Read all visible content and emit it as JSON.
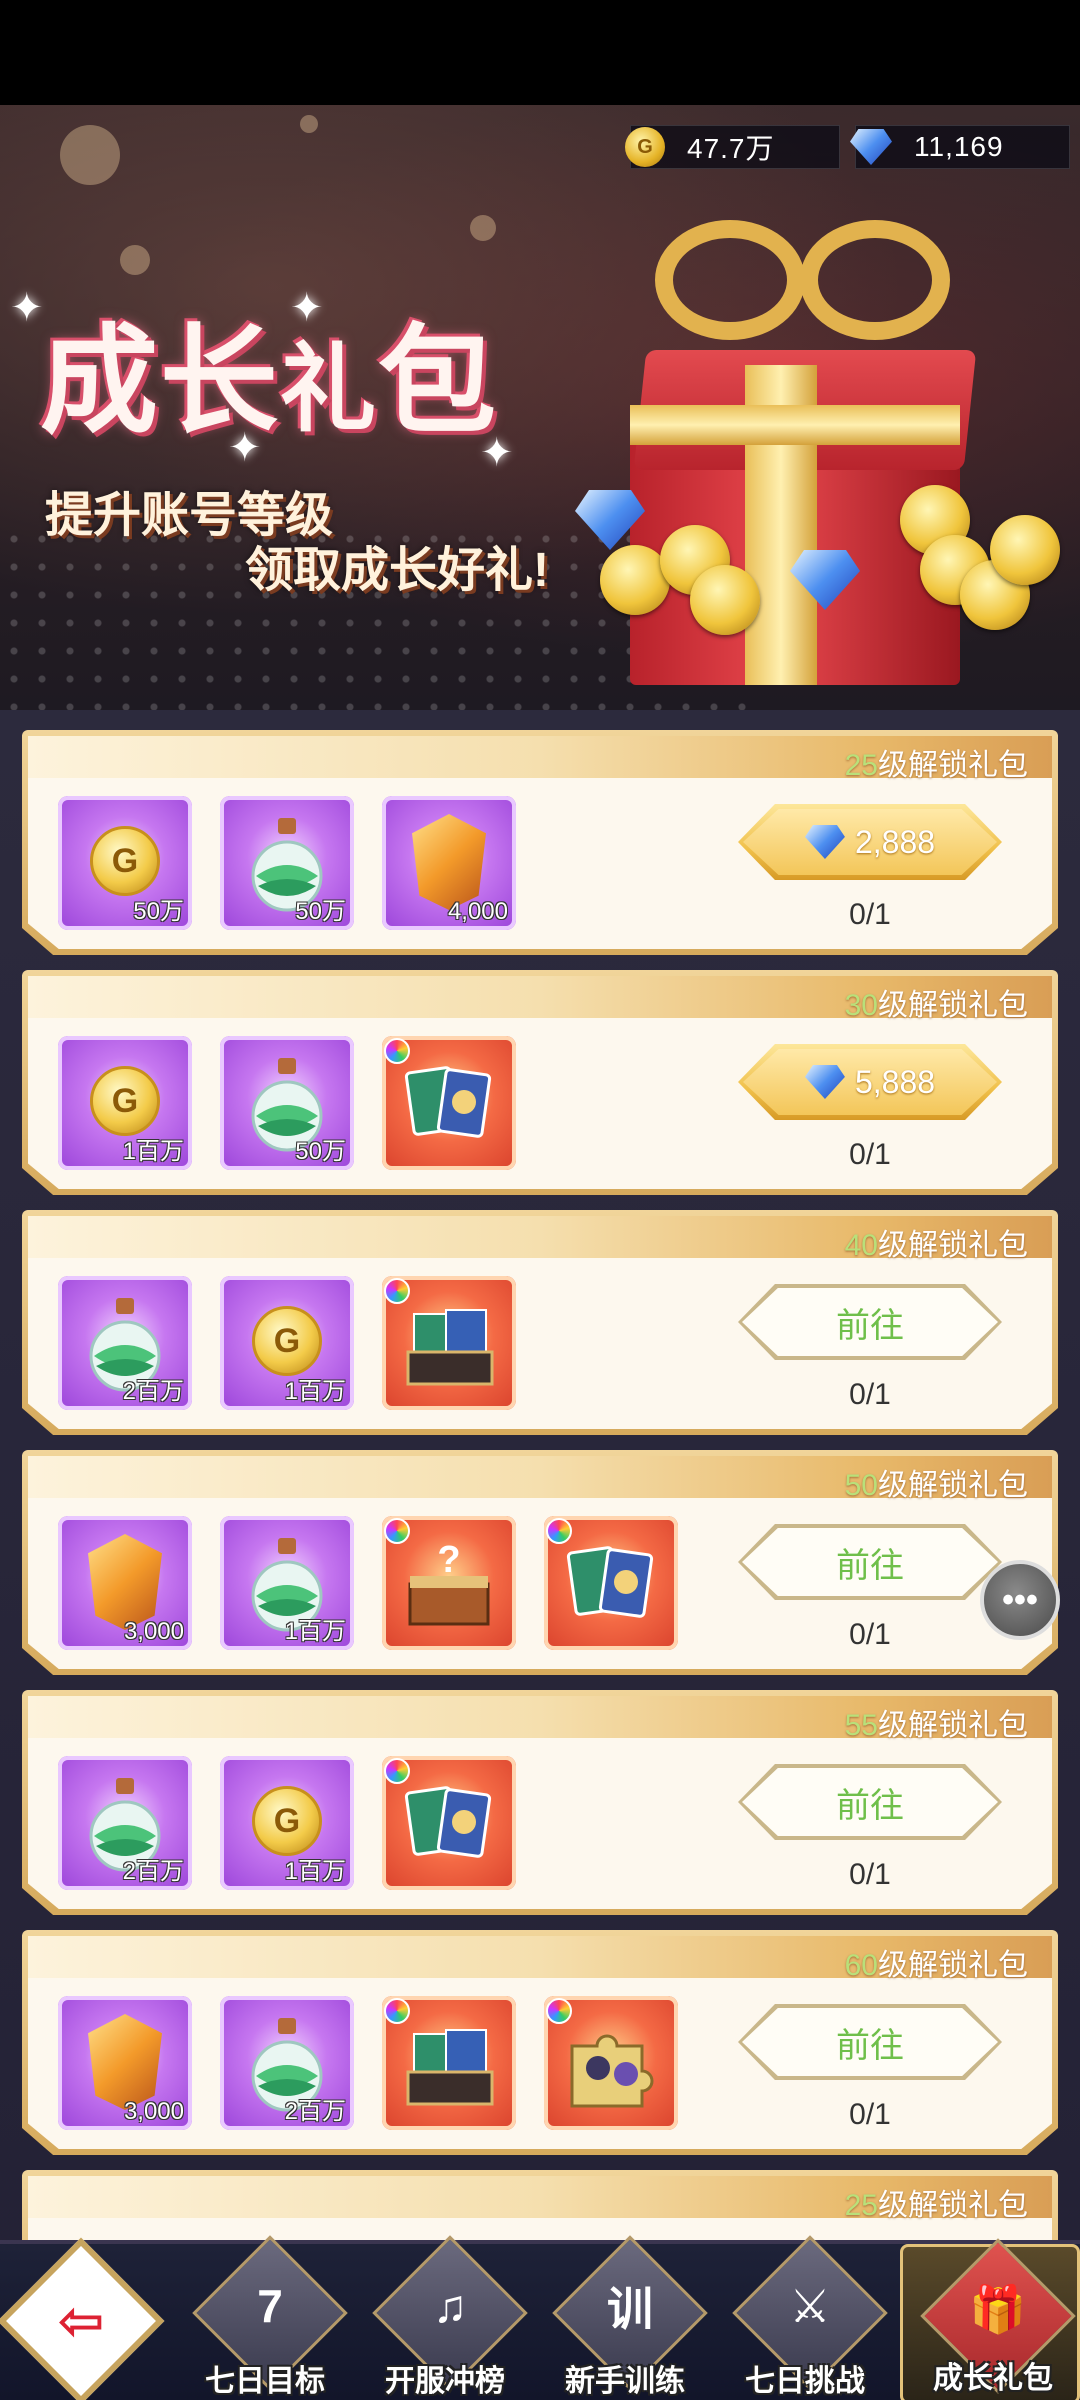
{
  "currency": {
    "gold_icon": "gold-coin-icon",
    "gold_coin_letter": "G",
    "gold_value": "47.7万",
    "gem_icon": "diamond-icon",
    "gem_value": "11,169"
  },
  "banner": {
    "title_part1": "成长",
    "title_part2": "礼",
    "title_part3": "包",
    "subtitle_line1": "提升账号等级",
    "subtitle_line2": "领取成长好礼!"
  },
  "colors": {
    "accent_gold": "#f0c04a",
    "go_text_green": "#6fbf4a",
    "level_text_green": "#b9e07a"
  },
  "packs": [
    {
      "level": "25",
      "suffix": "级解锁礼包",
      "items": [
        {
          "icon": "gold-coin-icon",
          "glyph": "G",
          "qty": "50万",
          "bg": "purple"
        },
        {
          "icon": "potion-bottle-icon",
          "qty": "50万",
          "bg": "purple"
        },
        {
          "icon": "amber-crystal-icon",
          "qty": "4,000",
          "bg": "purple"
        }
      ],
      "button": {
        "type": "price",
        "text": "2,888"
      },
      "progress": "0/1"
    },
    {
      "level": "30",
      "suffix": "级解锁礼包",
      "items": [
        {
          "icon": "gold-coin-icon",
          "glyph": "G",
          "qty": "1百万",
          "bg": "purple"
        },
        {
          "icon": "potion-bottle-icon",
          "qty": "50万",
          "bg": "purple"
        },
        {
          "icon": "card-pack-icon",
          "qty": "",
          "bg": "red"
        }
      ],
      "button": {
        "type": "price",
        "text": "5,888"
      },
      "progress": "0/1"
    },
    {
      "level": "40",
      "suffix": "级解锁礼包",
      "items": [
        {
          "icon": "potion-bottle-icon",
          "qty": "2百万",
          "bg": "purple"
        },
        {
          "icon": "gold-coin-icon",
          "glyph": "G",
          "qty": "1百万",
          "bg": "purple"
        },
        {
          "icon": "card-box-icon",
          "qty": "",
          "bg": "red"
        }
      ],
      "button": {
        "type": "go",
        "text": "前往"
      },
      "progress": "0/1"
    },
    {
      "level": "50",
      "suffix": "级解锁礼包",
      "items": [
        {
          "icon": "amber-crystal-icon",
          "qty": "3,000",
          "bg": "purple"
        },
        {
          "icon": "potion-bottle-icon",
          "qty": "1百万",
          "bg": "purple"
        },
        {
          "icon": "mystery-chest-icon",
          "qty": "",
          "bg": "red"
        },
        {
          "icon": "card-pack-icon",
          "qty": "",
          "bg": "red"
        }
      ],
      "button": {
        "type": "go",
        "text": "前往"
      },
      "progress": "0/1"
    },
    {
      "level": "55",
      "suffix": "级解锁礼包",
      "items": [
        {
          "icon": "potion-bottle-icon",
          "qty": "2百万",
          "bg": "purple"
        },
        {
          "icon": "gold-coin-icon",
          "glyph": "G",
          "qty": "1百万",
          "bg": "purple"
        },
        {
          "icon": "card-pack-icon",
          "qty": "",
          "bg": "red"
        }
      ],
      "button": {
        "type": "go",
        "text": "前往"
      },
      "progress": "0/1"
    },
    {
      "level": "60",
      "suffix": "级解锁礼包",
      "items": [
        {
          "icon": "amber-crystal-icon",
          "qty": "3,000",
          "bg": "purple"
        },
        {
          "icon": "potion-bottle-icon",
          "qty": "2百万",
          "bg": "purple"
        },
        {
          "icon": "card-box-icon",
          "qty": "",
          "bg": "red"
        },
        {
          "icon": "puzzle-piece-icon",
          "qty": "",
          "bg": "red"
        }
      ],
      "button": {
        "type": "go",
        "text": "前往"
      },
      "progress": "0/1"
    },
    {
      "level": "25",
      "suffix": "级解锁礼包",
      "items": [],
      "button": null,
      "progress": ""
    }
  ],
  "chat": {
    "icon": "chat-bubble-icon",
    "glyph": "•••"
  },
  "nav": {
    "back_icon": "exit-door-icon",
    "back_glyph": "⇦",
    "items": [
      {
        "label": "七日目标",
        "icon": "seven-day-goal-icon",
        "glyph": "7",
        "active": false
      },
      {
        "label": "开服冲榜",
        "icon": "ranking-horn-icon",
        "glyph": "♫",
        "active": false
      },
      {
        "label": "新手训练",
        "icon": "training-scroll-icon",
        "glyph": "训",
        "active": false
      },
      {
        "label": "七日挑战",
        "icon": "challenge-armor-icon",
        "glyph": "⚔",
        "active": false
      },
      {
        "label": "成长礼包",
        "icon": "growth-gift-icon",
        "glyph": "🎁",
        "active": true
      }
    ]
  }
}
